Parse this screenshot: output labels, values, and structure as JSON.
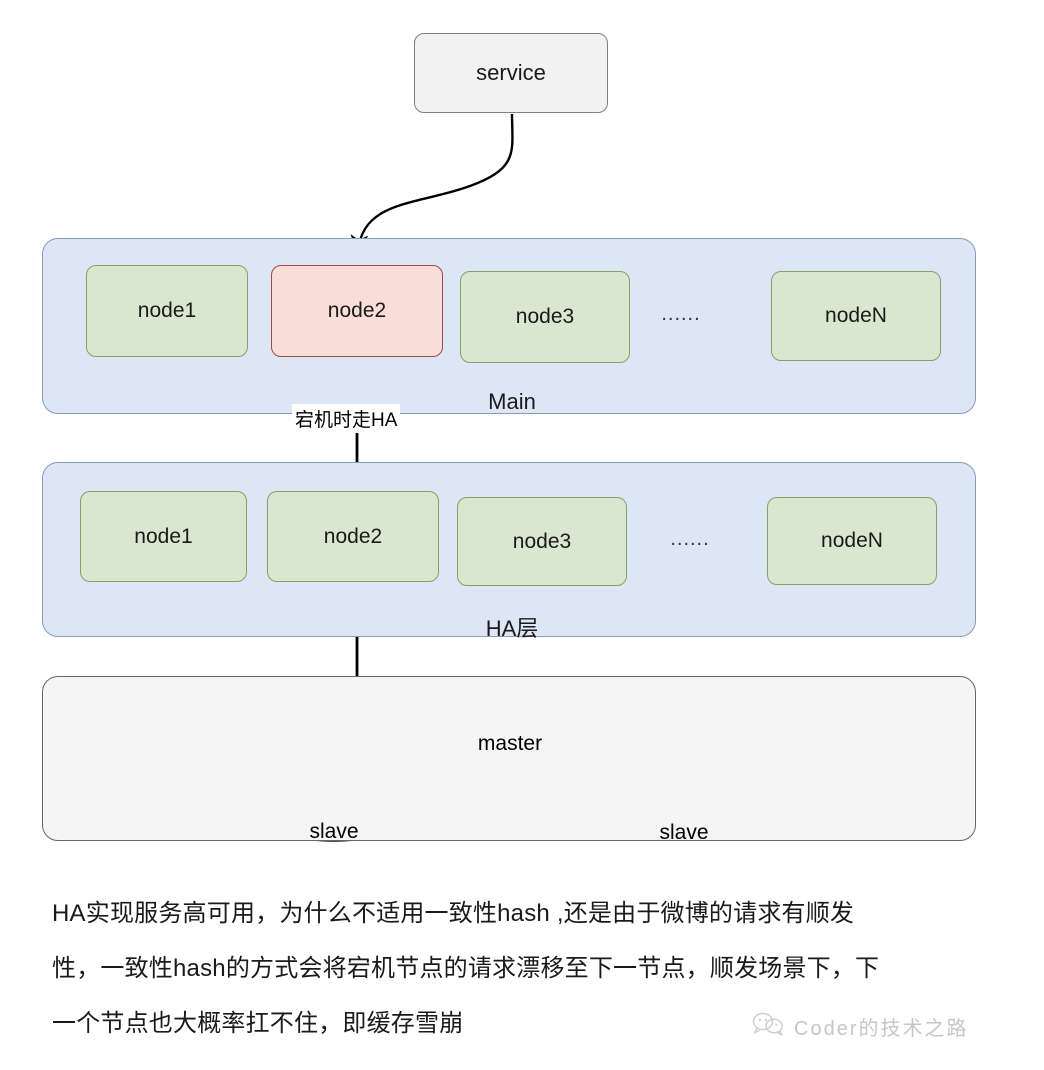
{
  "diagram": {
    "service": {
      "label": "service"
    },
    "layers": [
      {
        "name": "main-layer",
        "label": "Main",
        "nodes": [
          {
            "label": "node1",
            "state": "normal"
          },
          {
            "label": "node2",
            "state": "down"
          },
          {
            "label": "node3",
            "state": "normal"
          },
          {
            "label": "nodeN",
            "state": "normal"
          }
        ],
        "ellipsis": "......"
      },
      {
        "name": "ha-layer",
        "label": "HA层",
        "nodes": [
          {
            "label": "node1",
            "state": "normal"
          },
          {
            "label": "node2",
            "state": "normal"
          },
          {
            "label": "node3",
            "state": "normal"
          },
          {
            "label": "nodeN",
            "state": "normal"
          }
        ],
        "ellipsis": "......"
      }
    ],
    "edge_labels": {
      "down_to_ha": "宕机时走HA"
    },
    "storage": {
      "databases": [
        {
          "label": "master",
          "role": "master"
        },
        {
          "label": "slave",
          "role": "slave"
        },
        {
          "label": "slave",
          "role": "slave"
        }
      ]
    },
    "colors": {
      "node_normal_fill": "#d9e7d0",
      "node_normal_border": "#84a168",
      "node_down_fill": "#f8ddd8",
      "node_down_border": "#9e4a46",
      "layer_fill": "#dce6f5",
      "layer_border": "#8a9ab5",
      "service_fill": "#f2f2f2",
      "service_border": "#808080",
      "storage_fill": "#f5f5f5",
      "storage_border": "#666666",
      "db_fill": "#b8c4d4",
      "db_border": "#3f4f60",
      "arrow": "#000000"
    }
  },
  "caption": {
    "lines": [
      "HA实现服务高可用，为什么不适用一致性hash ,还是由于微博的请求有顺发",
      "性，一致性hash的方式会将宕机节点的请求漂移至下一节点，顺发场景下，下",
      "一个节点也大概率扛不住，即缓存雪崩"
    ]
  },
  "watermark": {
    "text": "Coder的技术之路",
    "icon": "wechat-icon"
  }
}
